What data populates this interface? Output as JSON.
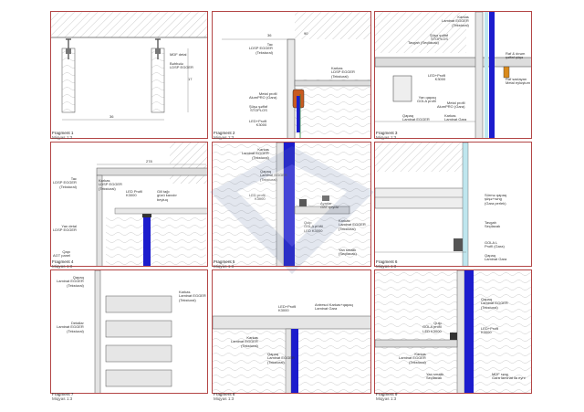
{
  "colors": {
    "frame": "#b34545",
    "led_strip": "#1c1ccd",
    "hatch": "#888888",
    "wood": "#c9c9c9",
    "line": "#555555"
  },
  "fragments": [
    {
      "title": "Fragment 1",
      "scale": "Miqyas 1:3",
      "labels": {
        "a": "MDF detal",
        "b": "Bəhbələ\nLDSP EGGER",
        "c": "17",
        "d": "36"
      }
    },
    {
      "title": "Fragment 2",
      "scale": "Miqyas 1:3",
      "labels": {
        "a": "Tac\nLDSP EGGER\n(Tekstural)",
        "b": "Karkas\nLDSP EGGER\n(Tekstural)",
        "c": "Metal profil\nAlumPRO (Gara)",
        "d": "Şüşə şəffaf\nSTOPLOS",
        "e": "LED+Profil\nK3000",
        "f": "90",
        "g": "36"
      }
    },
    {
      "title": "Fragment 3",
      "scale": "Miqyas 1:3",
      "labels": {
        "a": "Karkas\nLaminat EGGER\n(Tekstural)",
        "b": "Şüşə şəffaf\nSTOPLOS",
        "c": "Tavgah (Seçilacak)",
        "d": "Raf & dırəm\nşəffaf şüşə",
        "e": "Raf saxlayan\nMetal eyluştum",
        "f": "LED+Profil\nK3000",
        "g": "Metal profil\nAlumPRO (Gara)",
        "h": "Yan qapaq\nGOLA profil",
        "i": "Qapaq\nLaminat EGGER",
        "j": "Karkas\nLaminat Gara"
      }
    },
    {
      "title": "Fragment 4",
      "scale": "Miqyas 1:3",
      "labels": {
        "a": "Tac\nLDSP EGGER\n(Tekstural)",
        "b": "Karkas\nLDSP EGGER\n(Tekstural)",
        "c": "LED Profil\nK3000",
        "d": "Gill tağı\ngüzü kaxıdır\nbeyluq",
        "e": "Yan detal\nLDSP EGGER",
        "f": "Qapı\nAGT panel",
        "g": "278"
      }
    },
    {
      "title": "Fragment 5",
      "scale": "Miqyas 1:3",
      "labels": {
        "a": "Karkas\nLaminat EGGER\n(Tekstural)",
        "b": "Qapaq\nLaminat EGGER\n(Tekstural)",
        "c": "LED profil\nK3000",
        "d": "Ayarlar\nGAT qeydə",
        "e": "Qulp\nGOLA profil\nLED K3000",
        "f": "Karkas\nLaminat EGGER\n(Tekstural)",
        "g": "Yan smalik\n(Seçilacak)"
      }
    },
    {
      "title": "Fragment 6",
      "scale": "Miqyas 1:3",
      "labels": {
        "a": "Sürmə qapaq\nşüşə+rəng\n(Gara perlek)",
        "b": "Tavgah\nSeçilacak",
        "c": "GOLA L\nProfil (Gara)",
        "d": "Qapaq\nLaminat Gara"
      }
    },
    {
      "title": "Fragment 7",
      "scale": "Miqyas 1:3",
      "labels": {
        "a": "Qapaq\nLaminat EGGER\n(Tekstural)",
        "b": "Karkas\nLaminat EGGER\n(Tekstural)",
        "c": "Detallar\nLaminat EGGER\n(Tekstural)"
      }
    },
    {
      "title": "Fragment 8",
      "scale": "Miqyas 1:3",
      "labels": {
        "a": "LED+Profil\nK3000",
        "b": "Antresol Karkas+qapaq\nLaminat Gara",
        "c": "Karkas\nLaminat EGGER\n(Tekstural)",
        "d": "Qapaq\nLaminat EGGER\n(Tekstural)"
      }
    },
    {
      "title": "Fragment 9",
      "scale": "Miqyas 1:3",
      "labels": {
        "a": "Qapaq\nLaminat EGGER\n(Tekstural)",
        "b": "Qulp\nGOLA profil\nLED K3000",
        "c": "LED+Profil\nK3000",
        "d": "Karkas\nLaminat EGGER\n(Tekstural)",
        "e": "Yan smalik\nSeçilacak",
        "f": "MDF rəng\nGara laminat ila eyni"
      }
    }
  ]
}
